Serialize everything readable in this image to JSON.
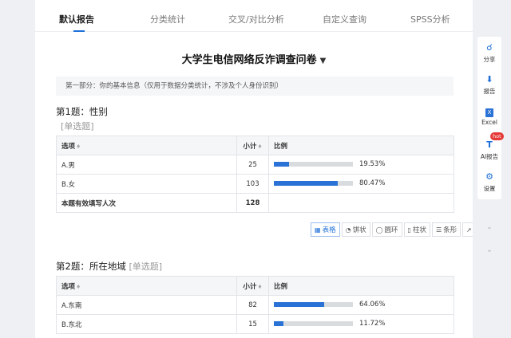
{
  "tabs": [
    "默认报告",
    "分类统计",
    "交叉/对比分析",
    "自定义查询",
    "SPSS分析"
  ],
  "survey_title": "大学生电信网络反诈调查问卷",
  "filter_icon": "filter-icon",
  "section_info": "第一部分：你的基本信息（仅用于数据分类统计，不涉及个人身份识别）",
  "table_headers": {
    "option": "选项",
    "count": "小计",
    "ratio": "比例"
  },
  "q1": {
    "title": "第1题：性别",
    "type": "[单选题]",
    "rows": [
      {
        "label": "A.男",
        "count": "25",
        "pct": "19.53%",
        "fraction": 0.1953
      },
      {
        "label": "B.女",
        "count": "103",
        "pct": "80.47%",
        "fraction": 0.8047
      }
    ],
    "total_label": "本题有效填写人次",
    "total": "128"
  },
  "chart_buttons": [
    "表格",
    "饼状",
    "圆环",
    "柱状",
    "条形",
    "折线"
  ],
  "q2": {
    "title": "第2题：所在地域",
    "type": "[单选题]",
    "rows": [
      {
        "label": "A.东南",
        "count": "82",
        "pct": "64.06%",
        "fraction": 0.6406
      },
      {
        "label": "B.东北",
        "count": "15",
        "pct": "11.72%",
        "fraction": 0.1172
      }
    ]
  },
  "sidebar": {
    "share": "分享",
    "report": "报告",
    "excel": "Excel",
    "ai_report": "AI报告",
    "hot": "hot",
    "settings": "设置",
    "excel_glyph": "X",
    "ai_glyph": "T"
  },
  "colors": {
    "accent": "#1e6fd9",
    "bar": "#2b72d6",
    "hot": "#e53935"
  }
}
